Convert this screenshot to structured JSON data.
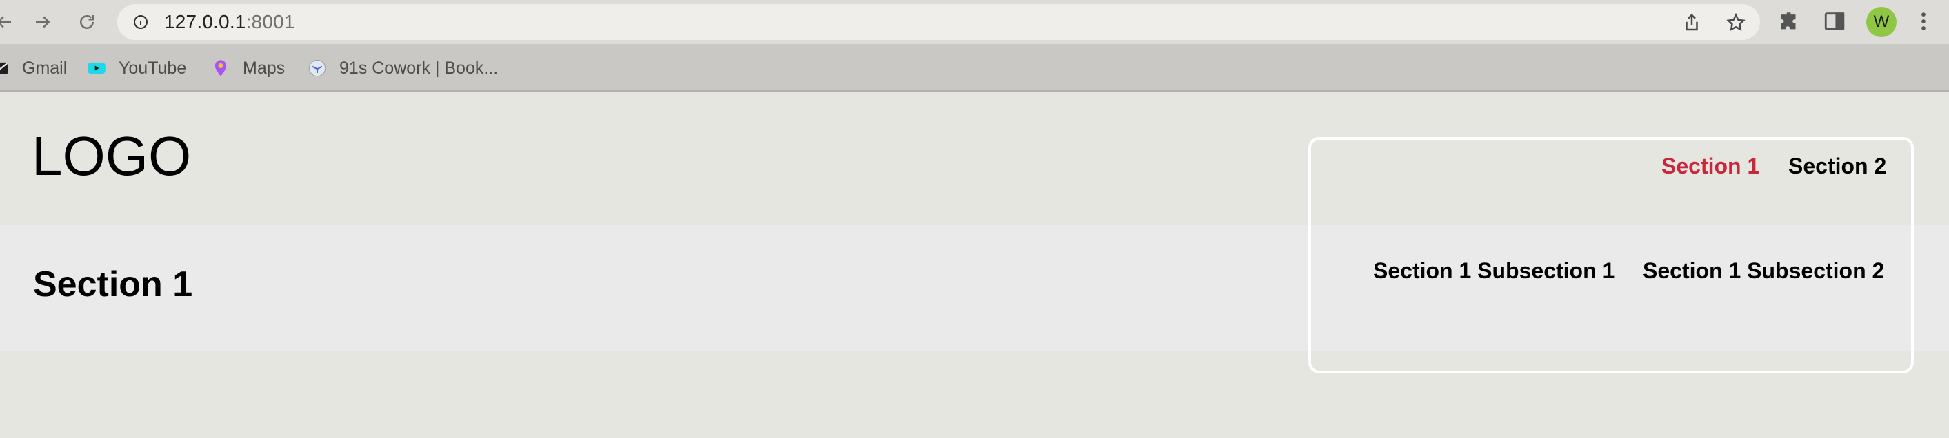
{
  "browser": {
    "url_host": "127.0.0.1",
    "url_port": ":8001",
    "profile_initial": "W",
    "bookmarks": [
      {
        "label": "Gmail",
        "icon": "gmail-icon"
      },
      {
        "label": "YouTube",
        "icon": "youtube-icon"
      },
      {
        "label": "Maps",
        "icon": "maps-icon"
      },
      {
        "label": "91s Cowork | Book...",
        "icon": "cowork-icon"
      }
    ]
  },
  "page": {
    "logo": "LOGO",
    "title": "Section 1",
    "nav": {
      "sections": [
        "Section 1",
        "Section 2"
      ],
      "subsections": [
        "Section 1 Subsection 1",
        "Section 1 Subsection 2"
      ]
    },
    "colors": {
      "active_link": "#c8283c",
      "nav_border": "#ffffff"
    }
  }
}
